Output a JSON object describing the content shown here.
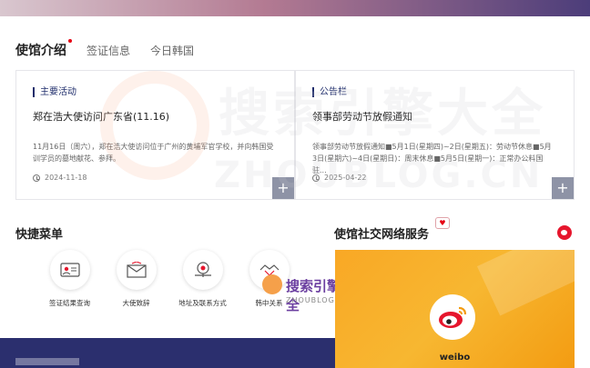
{
  "tabs": [
    {
      "label": "使馆介绍",
      "active": true
    },
    {
      "label": "签证信息",
      "active": false
    },
    {
      "label": "今日韩国",
      "active": false
    }
  ],
  "cards": [
    {
      "category": "主要活动",
      "title": "郑在浩大使访问广东省(11.16)",
      "description": "11月16日（周六），郑在浩大使访问位于广州的黄埔军官学校，并向韩国受训学员的墓地献花、参拜。",
      "date": "2024-11-18"
    },
    {
      "category": "公告栏",
      "title": "领事部劳动节放假通知",
      "description": "领事部劳动节放假通知■5月1日(星期四)~2日(星期五)：劳动节休息■5月3日(星期六)~4日(星期日)：周末休息■5月5日(星期一)：正常办公料国驻...",
      "date": "2025-04-22"
    }
  ],
  "quick_menu": {
    "title": "快捷菜单",
    "items": [
      {
        "label": "签证结果查询",
        "icon": "id-card-icon"
      },
      {
        "label": "大使致辞",
        "icon": "envelope-icon"
      },
      {
        "label": "地址及联系方式",
        "icon": "map-pin-icon"
      },
      {
        "label": "韩中关系",
        "icon": "handshake-icon"
      }
    ]
  },
  "social": {
    "title": "使馆社交网络服务",
    "weibo_label": "weibo"
  },
  "watermark": {
    "cn": "搜索引擎大全",
    "en": "ZHOUBLOG.CN"
  },
  "colors": {
    "accent_navy": "#1f2d6b",
    "weibo_red": "#e6162d",
    "weibo_orange": "#f7b731"
  }
}
